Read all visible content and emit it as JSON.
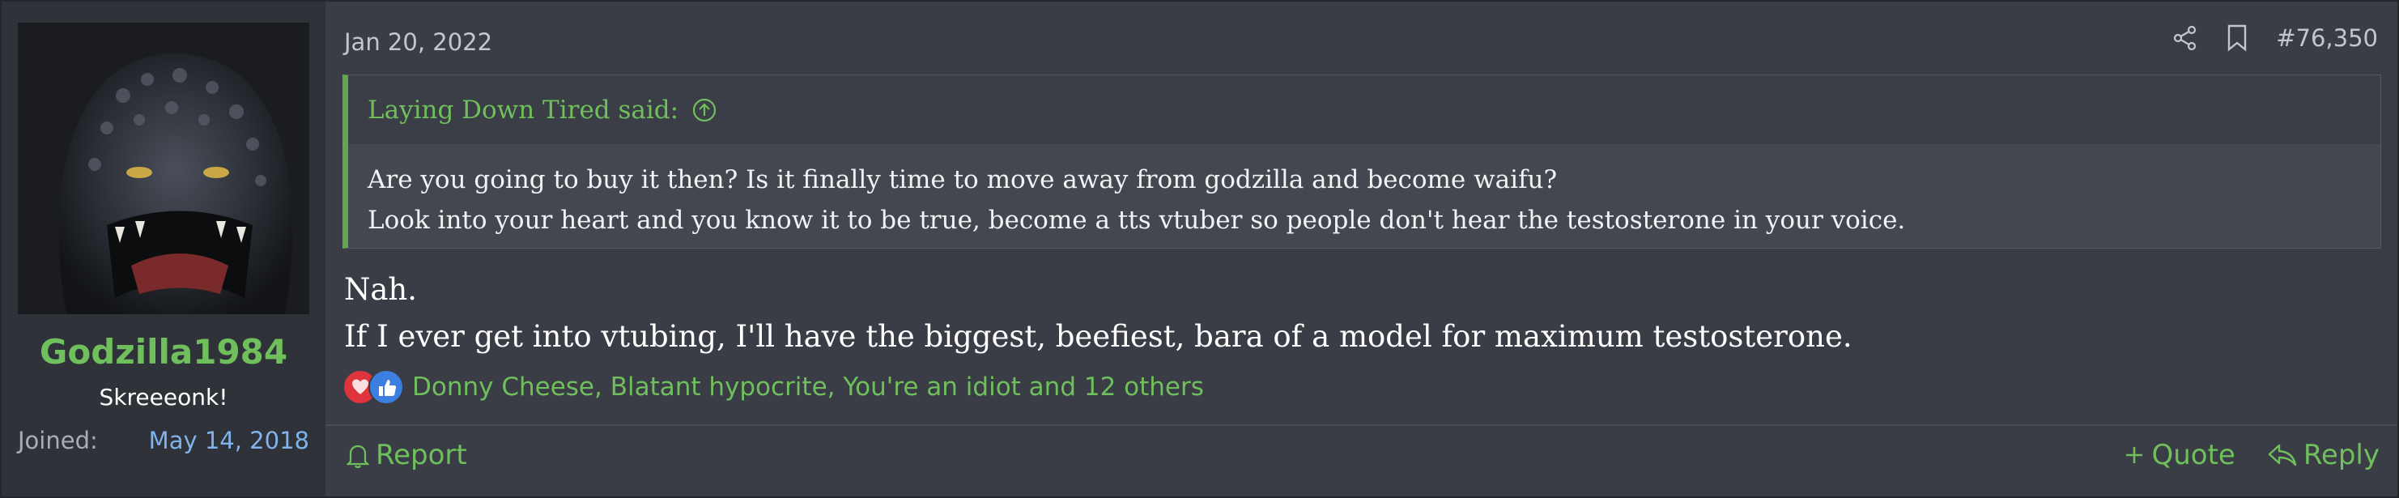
{
  "author": {
    "username": "Godzilla1984",
    "user_title": "Skreeeonk!",
    "joined_label": "Joined:",
    "joined_date": "May 14, 2018"
  },
  "post": {
    "date": "Jan 20, 2022",
    "number": "#76,350"
  },
  "quote": {
    "attribution": "Laying Down Tired said:",
    "lines": [
      "Are you going to buy it then? Is it finally time to move away from godzilla and become waifu?",
      "Look into your heart and you know it to be true, become a tts vtuber so people don't hear the testosterone in your voice."
    ]
  },
  "message": {
    "lines": [
      "Nah.",
      "If I ever get into vtubing, I'll have the biggest, beefiest, bara of a model for maximum testosterone."
    ]
  },
  "reactions": {
    "summary": "Donny Cheese, Blatant hypocrite, You're an idiot and 12 others",
    "icons": [
      "heart-reaction-icon",
      "like-reaction-icon"
    ]
  },
  "actions": {
    "report": "Report",
    "quote": "Quote",
    "reply": "Reply"
  },
  "colors": {
    "accent_green": "#6fbf5c",
    "link_blue": "#7fb3ea",
    "post_bg": "#3a3d45",
    "sidebar_bg": "#2f3239"
  },
  "icons": {
    "share": "share-icon",
    "bookmark": "bookmark-icon",
    "quote_jump": "arrow-up-circle-icon",
    "report": "bell-icon",
    "quote": "plus-icon",
    "reply": "reply-arrow-icon"
  }
}
